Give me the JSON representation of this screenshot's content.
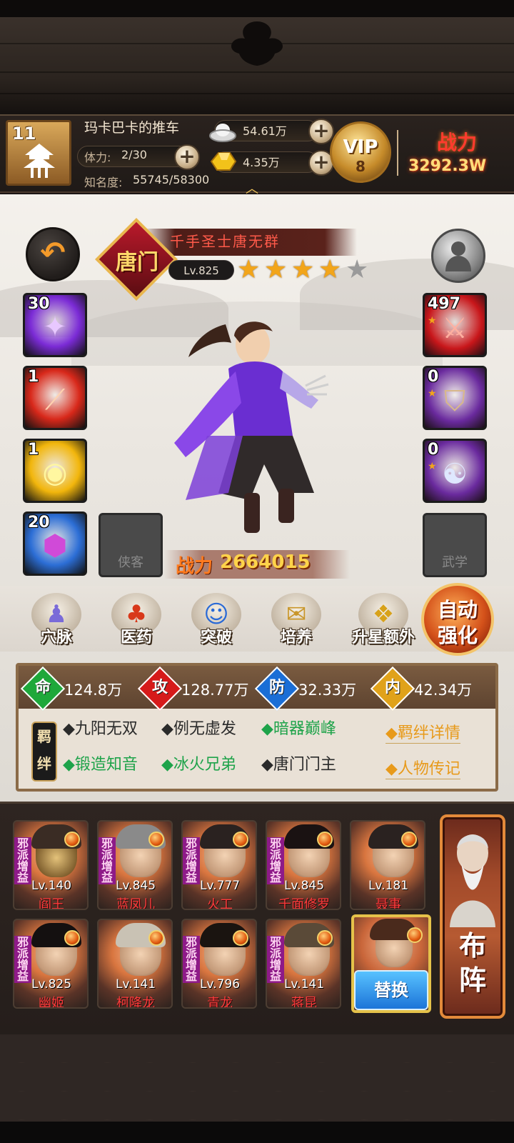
{
  "header": {
    "player_level": "11",
    "player_name": "玛卡巴卡的推车",
    "stamina_label": "体力:",
    "stamina_value": "2/30",
    "fame_label": "知名度:",
    "fame_value": "55745/58300",
    "silver": "54.61万",
    "gold": "4.35万",
    "vip_label": "VIP",
    "vip_level": "8",
    "total_power_label": "战力",
    "total_power_value": "3292.3W"
  },
  "hero": {
    "name": "千手圣士唐无群",
    "class_emblem": "唐门",
    "level": "Lv.825",
    "stars_on": 4,
    "stars_total": 5,
    "power_label": "战力",
    "power_value": "2664015"
  },
  "skills": [
    {
      "count": "30",
      "color": "#7b2bd6"
    },
    {
      "count": "1",
      "color": "#d8281a"
    },
    {
      "count": "1",
      "color": "#f2b60c"
    },
    {
      "count": "20",
      "color": "#2c6ed6"
    }
  ],
  "empty_slots": {
    "companion": "侠客",
    "martial_art": "武学"
  },
  "equipment": [
    {
      "count": "497",
      "color": "#c8161a"
    },
    {
      "count": "0",
      "color": "#6a2a9e"
    },
    {
      "count": "0",
      "color": "#6a2a9e"
    }
  ],
  "functions": [
    {
      "label": "穴脉",
      "icon": "meridian-icon"
    },
    {
      "label": "医药",
      "icon": "mushroom-icon"
    },
    {
      "label": "突破",
      "icon": "breakthrough-icon"
    },
    {
      "label": "培养",
      "icon": "scroll-icon"
    },
    {
      "label": "升星额外",
      "icon": "treasure-icon"
    }
  ],
  "auto_enhance": {
    "line1": "自动",
    "line2": "强化"
  },
  "attributes": [
    {
      "char": "命",
      "value": "124.8万",
      "color": "#1ea83a"
    },
    {
      "char": "攻",
      "value": "128.77万",
      "color": "#d61a1a"
    },
    {
      "char": "防",
      "value": "32.33万",
      "color": "#1a6ed6"
    },
    {
      "char": "内",
      "value": "42.34万",
      "color": "#e0a21a"
    }
  ],
  "bond_tag": "羁绊",
  "bonds": [
    {
      "label": "◆九阳无双",
      "active": false
    },
    {
      "label": "◆例无虚发",
      "active": false
    },
    {
      "label": "◆暗器巅峰",
      "active": true
    },
    {
      "label": "◆锻造知音",
      "active": true
    },
    {
      "label": "◆冰火兄弟",
      "active": true
    },
    {
      "label": "◆唐门门主",
      "active": false
    }
  ],
  "bond_links": {
    "details": "◆羁绊详情",
    "biography": "◆人物传记"
  },
  "lineup": [
    {
      "level": "Lv.140",
      "name": "阎王",
      "tag": "邪派增益"
    },
    {
      "level": "Lv.845",
      "name": "蓝凤儿",
      "tag": "邪派增益"
    },
    {
      "level": "Lv.777",
      "name": "火工",
      "tag": "邪派增益"
    },
    {
      "level": "Lv.845",
      "name": "千面修罗",
      "tag": "邪派增益"
    },
    {
      "level": "Lv.181",
      "name": "聂事",
      "tag": ""
    },
    {
      "level": "Lv.825",
      "name": "幽姬",
      "tag": "邪派增益"
    },
    {
      "level": "Lv.141",
      "name": "柯降龙",
      "tag": ""
    },
    {
      "level": "Lv.796",
      "name": "青龙",
      "tag": "邪派增益"
    },
    {
      "level": "Lv.141",
      "name": "蒋昆",
      "tag": "邪派增益"
    }
  ],
  "replace_button": "替换",
  "formation_button": "布阵"
}
